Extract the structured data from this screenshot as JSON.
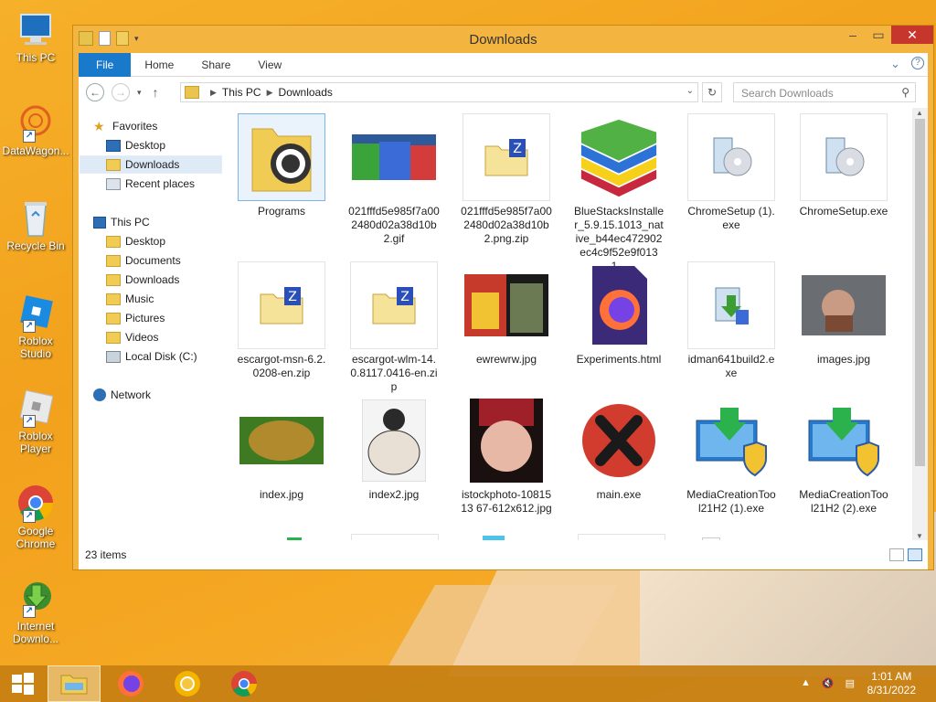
{
  "desktop": {
    "icons": [
      {
        "label": "This PC"
      },
      {
        "label": "DataWagon..."
      },
      {
        "label": "Recycle Bin"
      },
      {
        "label": "Roblox Studio"
      },
      {
        "label": "Roblox Player"
      },
      {
        "label": "Google Chrome"
      },
      {
        "label": "Internet Downlo..."
      }
    ]
  },
  "window": {
    "title": "Downloads",
    "ribbon": {
      "file": "File",
      "home": "Home",
      "share": "Share",
      "view": "View"
    },
    "address": {
      "root": "This PC",
      "current": "Downloads"
    },
    "search_placeholder": "Search Downloads",
    "nav": {
      "favorites": "Favorites",
      "fav_items": [
        "Desktop",
        "Downloads",
        "Recent places"
      ],
      "this_pc": "This PC",
      "pc_items": [
        "Desktop",
        "Documents",
        "Downloads",
        "Music",
        "Pictures",
        "Videos",
        "Local Disk (C:)"
      ],
      "network": "Network"
    },
    "files": [
      "Programs",
      "021fffd5e985f7a002480d02a38d10b2.gif",
      "021fffd5e985f7a002480d02a38d10b2.png.zip",
      "BlueStacksInstaller_5.9.15.1013_native_b44ec472902ec4c9f52e9f0131...",
      "ChromeSetup (1).exe",
      "ChromeSetup.exe",
      "escargot-msn-6.2.0208-en.zip",
      "escargot-wlm-14.0.8117.0416-en.zip",
      "ewrewrw.jpg",
      "Experiments.html",
      "idman641build2.exe",
      "images.jpg",
      "index.jpg",
      "index2.jpg",
      "istockphoto-1081513 67-612x612.jpg",
      "main.exe",
      "MediaCreationTool21H2 (1).exe",
      "MediaCreationTool21H2 (2).exe"
    ],
    "status": "23 items"
  },
  "taskbar": {
    "time": "1:01 AM",
    "date": "8/31/2022"
  },
  "colors": {
    "accent": "#1979ca",
    "window_frame": "#f3b440",
    "close": "#c7362c",
    "taskbar": "#c67f12"
  }
}
